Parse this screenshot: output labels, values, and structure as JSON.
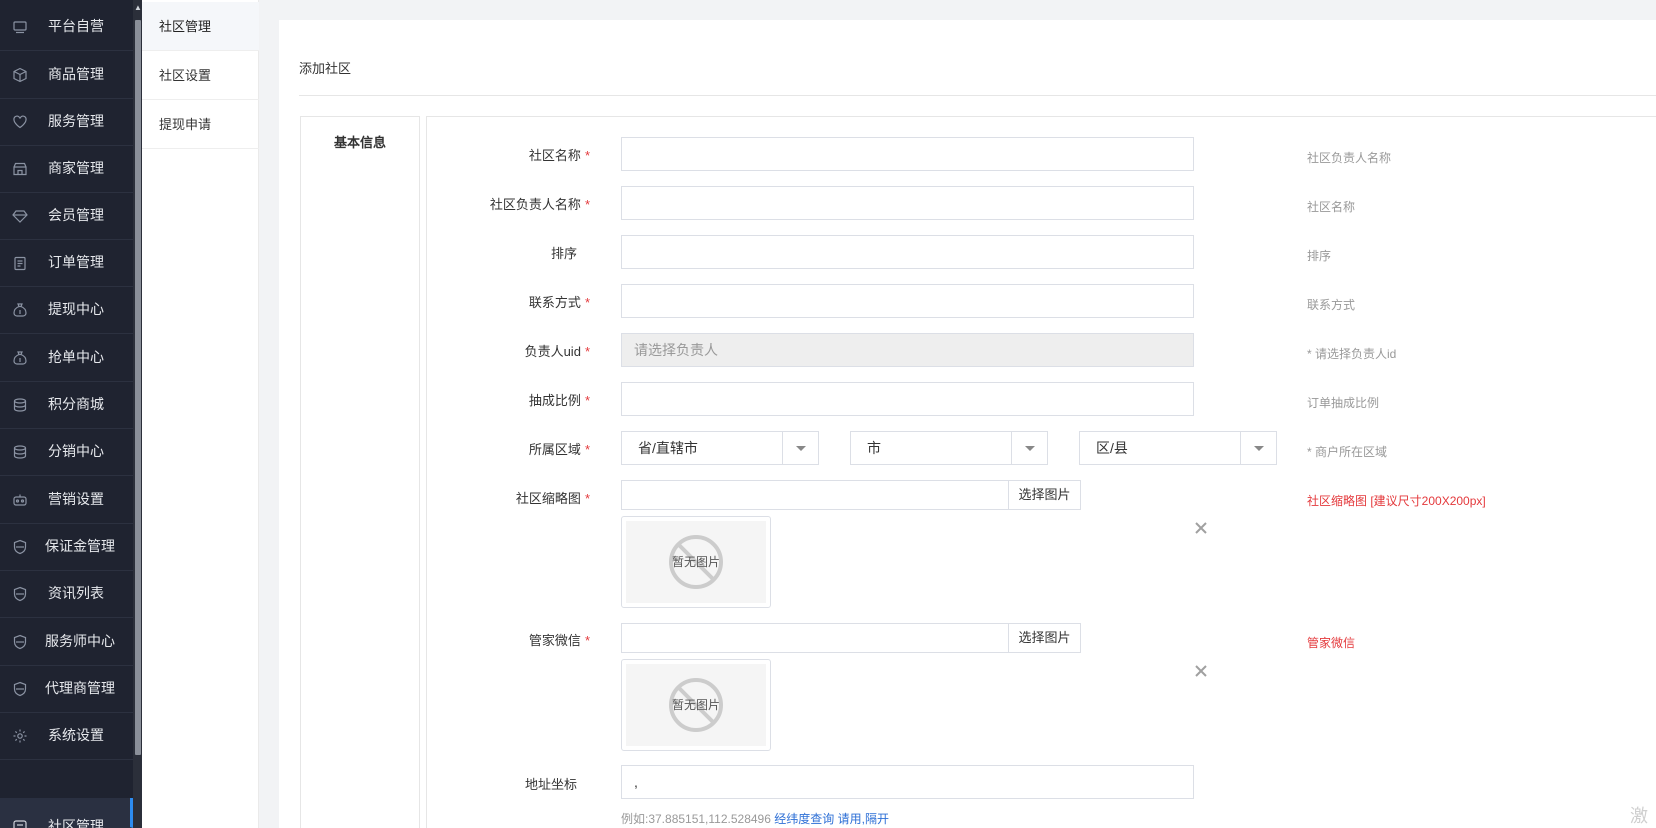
{
  "sidebar": {
    "items": [
      {
        "label": "平台自营",
        "icon": "monitor-icon"
      },
      {
        "label": "商品管理",
        "icon": "box-icon"
      },
      {
        "label": "服务管理",
        "icon": "heart-icon"
      },
      {
        "label": "商家管理",
        "icon": "store-icon"
      },
      {
        "label": "会员管理",
        "icon": "diamond-icon"
      },
      {
        "label": "订单管理",
        "icon": "clipboard-icon"
      },
      {
        "label": "提现中心",
        "icon": "money-bag-icon"
      },
      {
        "label": "抢单中心",
        "icon": "money-bag-icon"
      },
      {
        "label": "积分商城",
        "icon": "database-icon"
      },
      {
        "label": "分销中心",
        "icon": "database-icon"
      },
      {
        "label": "营销设置",
        "icon": "robot-icon"
      },
      {
        "label": "保证金管理",
        "icon": "shield-icon"
      },
      {
        "label": "资讯列表",
        "icon": "shield-icon"
      },
      {
        "label": "服务师中心",
        "icon": "shield-icon"
      },
      {
        "label": "代理商管理",
        "icon": "shield-icon"
      },
      {
        "label": "系统设置",
        "icon": "gear-icon"
      },
      {
        "label": "社区管理",
        "icon": "community-icon"
      }
    ]
  },
  "subnav": {
    "items": [
      {
        "label": "社区管理"
      },
      {
        "label": "社区设置"
      },
      {
        "label": "提现申请"
      }
    ]
  },
  "page": {
    "title": "添加社区",
    "tab": "基本信息"
  },
  "form": {
    "name": {
      "label": "社区名称",
      "value": "",
      "hint": "社区负责人名称"
    },
    "manager_name": {
      "label": "社区负责人名称",
      "value": "",
      "hint": "社区名称"
    },
    "sort": {
      "label": "排序",
      "value": "",
      "hint": "排序"
    },
    "contact": {
      "label": "联系方式",
      "value": "",
      "hint": "联系方式"
    },
    "uid": {
      "label": "负责人uid",
      "placeholder": "请选择负责人",
      "hint": "* 请选择负责人id"
    },
    "ratio": {
      "label": "抽成比例",
      "value": "",
      "hint": "订单抽成比例"
    },
    "region": {
      "label": "所属区域",
      "province": "省/直辖市",
      "city": "市",
      "district": "区/县",
      "hint": "* 商户所在区域"
    },
    "thumbnail": {
      "label": "社区缩略图",
      "button": "选择图片",
      "no_image": "暂无图片",
      "hint": "社区缩略图 [建议尺寸200X200px]"
    },
    "wechat": {
      "label": "管家微信",
      "button": "选择图片",
      "no_image": "暂无图片",
      "hint": "管家微信"
    },
    "coords": {
      "label": "地址坐标",
      "value": ",",
      "example_prefix": "例如:37.885151,112.528496",
      "example_link": "经纬度查询",
      "example_suffix": "请用,隔开"
    }
  },
  "watermark": "激活",
  "colors": {
    "accent": "#2d8cf0",
    "required": "#e4393c",
    "sidebar_bg": "#1f2330"
  }
}
